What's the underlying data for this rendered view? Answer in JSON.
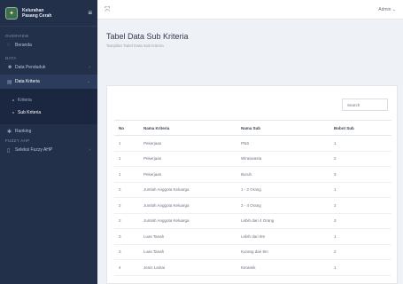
{
  "brand": {
    "line1": "Kelurahan",
    "line2": "Pasang Cerah"
  },
  "sidebar": {
    "section_overview": "OVERVIEW",
    "beranda": "Beranda",
    "section_data": "DATA",
    "data_penduduk": "Data Penduduk",
    "data_kriteria": "Data Kriteria",
    "kriteria": "Kriteria",
    "sub_kriteria": "Sub Kriteria",
    "ranking": "Ranking",
    "section_fuzzy": "FUZZY AHP",
    "seleksi_fuzzy": "Seleksi Fuzzy AHP"
  },
  "topbar": {
    "user": "Admin ⌄"
  },
  "page": {
    "title": "Tabel Data Sub Kriteria",
    "subtitle": "Tampilan Tabel Data Sub kriteria"
  },
  "search": {
    "placeholder": "Search"
  },
  "table": {
    "headers": [
      "No",
      "Nama Kriteria",
      "Nama Sub",
      "Bobot Sub"
    ],
    "rows": [
      [
        "1",
        "Pekerjaan",
        "PNS",
        "1"
      ],
      [
        "1",
        "Pekerjaan",
        "Wiraswasta",
        "2"
      ],
      [
        "1",
        "Pekerjaan",
        "Buruh",
        "3"
      ],
      [
        "2",
        "Jumlah Anggota Keluarga",
        "1 - 2 Orang",
        "1"
      ],
      [
        "2",
        "Jumlah Anggota Keluarga",
        "2 - 4 Orang",
        "2"
      ],
      [
        "2",
        "Jumlah Anggota Keluarga",
        "Lebih dari 4 Orang",
        "3"
      ],
      [
        "3",
        "Luas Tanah",
        "Lebih dari 8m",
        "1"
      ],
      [
        "3",
        "Luas Tanah",
        "Kurang dari 8m",
        "2"
      ],
      [
        "4",
        "Jenis Lantai",
        "Keramik",
        "1"
      ]
    ]
  }
}
